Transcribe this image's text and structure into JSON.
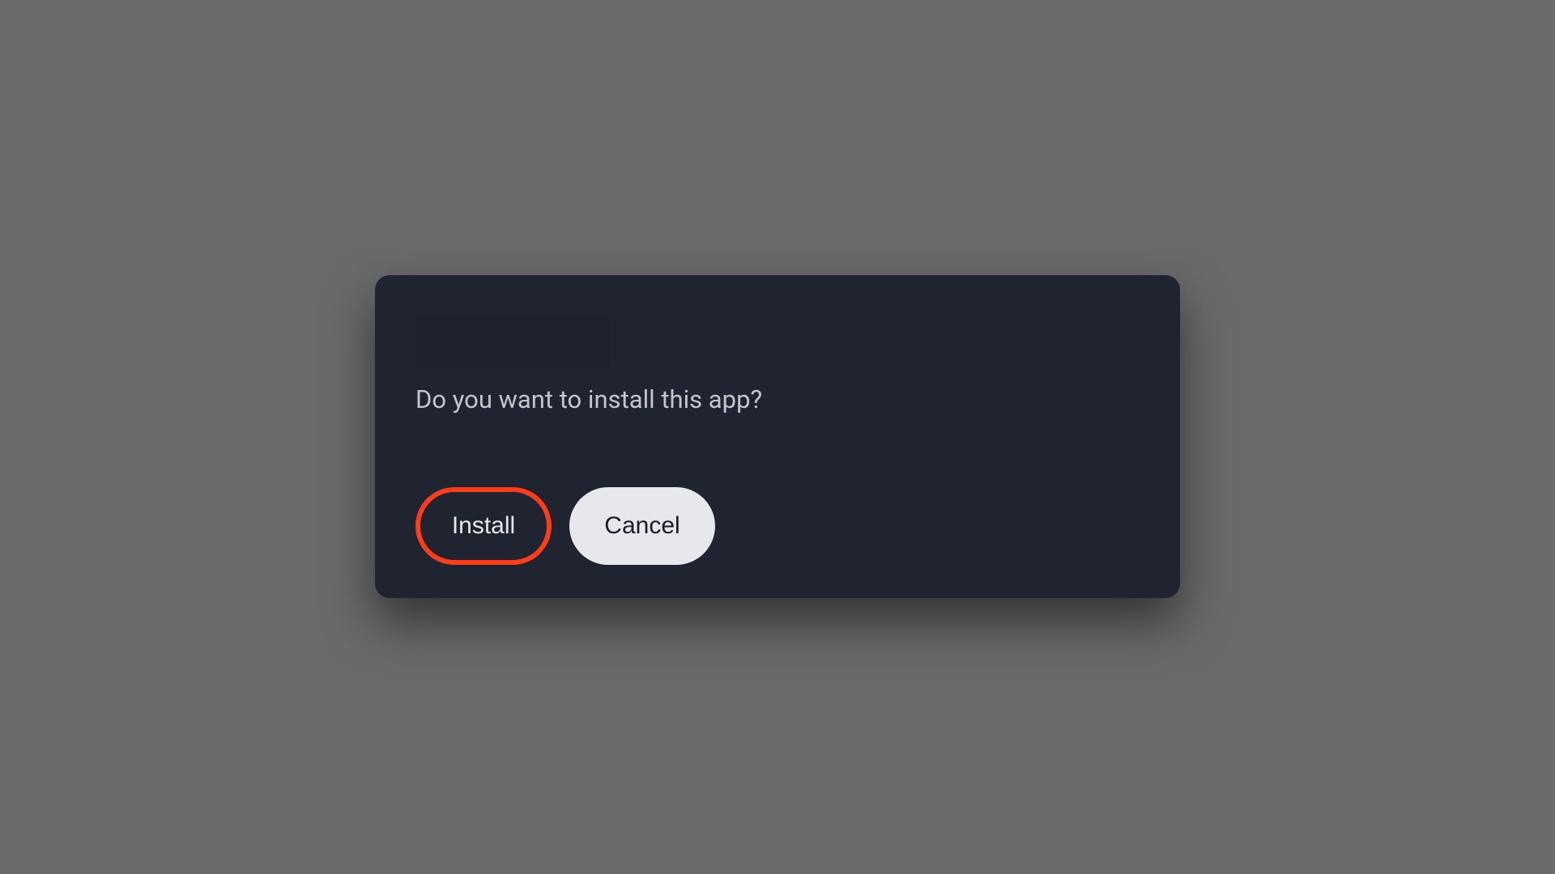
{
  "dialog": {
    "message": "Do you want to install this app?",
    "install_label": "Install",
    "cancel_label": "Cancel"
  }
}
